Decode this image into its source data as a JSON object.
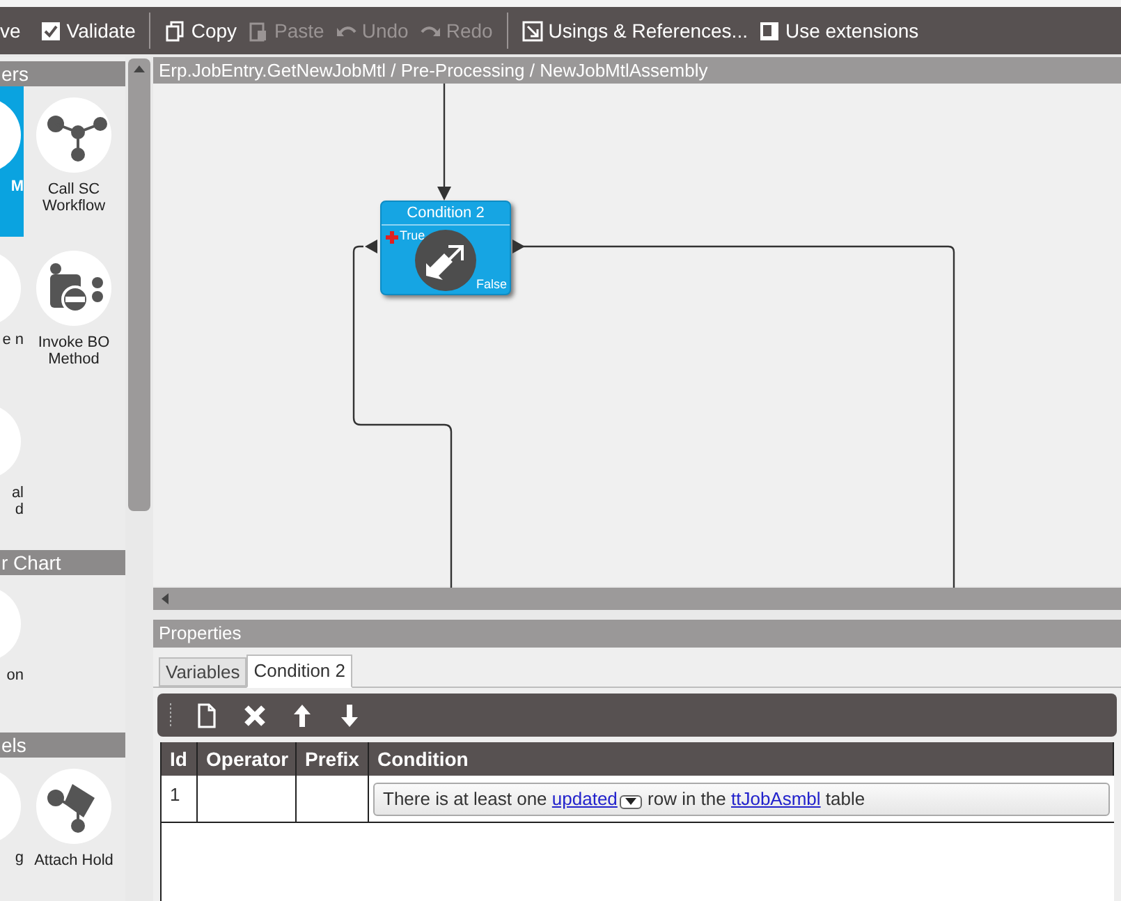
{
  "toolbar": {
    "items": [
      {
        "label": "ve",
        "disabled": false
      },
      {
        "label": "Validate",
        "disabled": false
      },
      {
        "label": "Copy",
        "disabled": false
      },
      {
        "label": "Paste",
        "disabled": true
      },
      {
        "label": "Undo",
        "disabled": true
      },
      {
        "label": "Redo",
        "disabled": true
      },
      {
        "label": "Usings & References...",
        "disabled": false
      },
      {
        "label": "Use extensions",
        "disabled": false
      }
    ]
  },
  "palette": {
    "sections": [
      {
        "header": "ers",
        "rows": [
          [
            {
              "label": "M",
              "selected": true
            },
            {
              "label": "Call SC Workflow",
              "selected": false
            }
          ],
          [
            {
              "label": "e n",
              "selected": false
            },
            {
              "label": "Invoke BO Method",
              "selected": false
            }
          ],
          [
            {
              "label": "al d",
              "selected": false
            }
          ]
        ]
      },
      {
        "header": "r Chart",
        "rows": [
          [
            {
              "label": "on",
              "selected": false
            }
          ]
        ]
      },
      {
        "header": "els",
        "rows": [
          [
            {
              "label": "g",
              "selected": false
            },
            {
              "label": "Attach Hold",
              "selected": false
            }
          ]
        ]
      }
    ]
  },
  "breadcrumb": "Erp.JobEntry.GetNewJobMtl / Pre-Processing / NewJobMtlAssembly",
  "node": {
    "title": "Condition 2",
    "true_label": "True",
    "false_label": "False"
  },
  "properties": {
    "title": "Properties",
    "tabs": [
      {
        "label": "Variables",
        "selected": false
      },
      {
        "label": "Condition 2",
        "selected": true
      }
    ],
    "table": {
      "columns": [
        "Id",
        "Operator",
        "Prefix",
        "Condition"
      ],
      "rows": [
        {
          "id": "1",
          "operator": "",
          "prefix": "",
          "condition": [
            {
              "kind": "text",
              "text": "There is at least one "
            },
            {
              "kind": "link",
              "text": "updated",
              "dropdown": true
            },
            {
              "kind": "text",
              "text": " row in the "
            },
            {
              "kind": "link",
              "text": "ttJobAsmbl",
              "dropdown": false
            },
            {
              "kind": "text",
              "text": " table"
            }
          ]
        }
      ]
    }
  }
}
